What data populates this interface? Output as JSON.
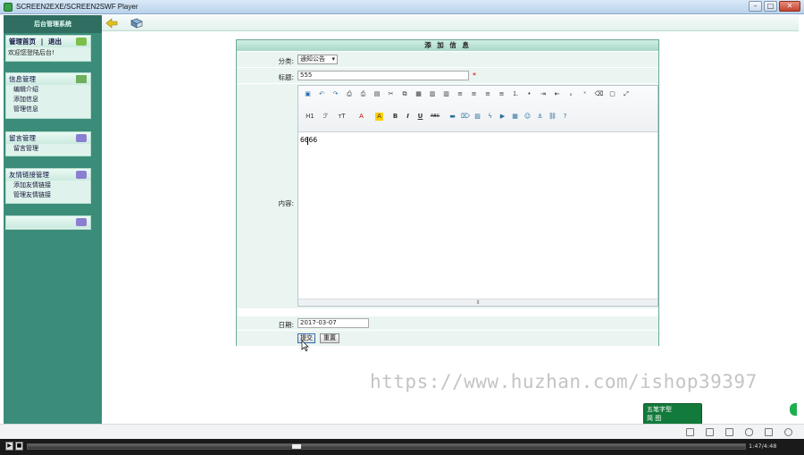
{
  "window": {
    "title": "SCREEN2EXE/SCREEN2SWF Player",
    "buttons": {
      "minimize": "–",
      "maximize": "□",
      "close": "✕"
    }
  },
  "sidebar": {
    "header": "后台管理系统",
    "top_links": {
      "home": "管理首页",
      "separator": "|",
      "logout": "退出"
    },
    "welcome": "欢迎您登陆后台!",
    "sections": [
      {
        "title": "信息管理",
        "items": [
          "编辑介绍",
          "添加信息",
          "管理信息"
        ]
      },
      {
        "title": "留言管理",
        "items": [
          "留言管理"
        ]
      },
      {
        "title": "友情链接管理",
        "items": [
          "添加友情链接",
          "管理友情链接"
        ]
      },
      {
        "title": "",
        "items": []
      }
    ]
  },
  "form": {
    "header": "添 加 信 息",
    "category": {
      "label": "分类:",
      "value": "通知公告"
    },
    "title": {
      "label": "标题:",
      "value": "555",
      "required_mark": "*"
    },
    "content": {
      "label": "内容:",
      "value": "6666"
    },
    "date": {
      "label": "日期:",
      "value": "2017-03-07"
    },
    "submit_label": "提交",
    "reset_label": "重置"
  },
  "editor": {
    "toolbar_row1": [
      "source",
      "undo",
      "redo",
      "preview",
      "print",
      "template",
      "cut-icon",
      "copy",
      "paste",
      "paste-text",
      "paste-word",
      "align-left",
      "align-center",
      "align-right",
      "justify",
      "ol",
      "ul",
      "indent",
      "outdent",
      "subscript",
      "superscript",
      "clear-format",
      "select-all",
      "fullscreen"
    ],
    "toolbar_row2": [
      "H1",
      "F",
      "T",
      "A",
      "A",
      "B",
      "I",
      "U",
      "ABC",
      "hr",
      "eraser",
      "image",
      "flash",
      "media",
      "table",
      "emoticon",
      "link",
      "unlink",
      "about"
    ],
    "heading_label": "H1",
    "bold_label": "B",
    "italic_label": "I",
    "underline_label": "U",
    "strike_label": "ABC"
  },
  "watermark": "https://www.huzhan.com/ishop39397",
  "ime": {
    "line1": "五笔字型",
    "line2": "简 图"
  },
  "player": {
    "time": "1:47/4:48"
  },
  "colors": {
    "sidebar": "#3b8d7a",
    "accent": "#6aa89a",
    "required": "#dd0000"
  }
}
